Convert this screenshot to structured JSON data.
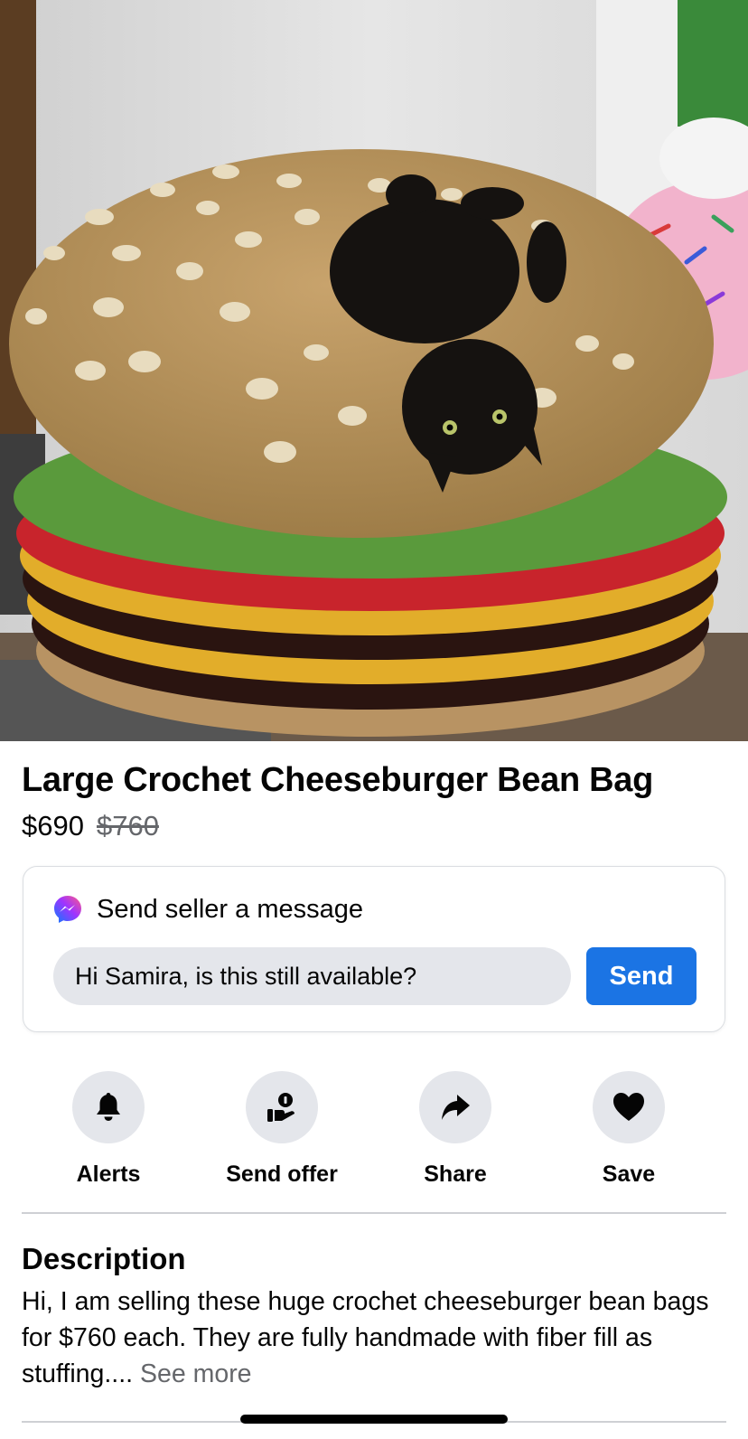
{
  "listing": {
    "title": "Large Crochet Cheeseburger Bean Bag",
    "price": "$690",
    "original_price": "$760",
    "photo_icon": "product-photo"
  },
  "message_card": {
    "heading": "Send seller a message",
    "icon": "messenger-icon",
    "input_value": "Hi Samira, is this still available?",
    "send_label": "Send"
  },
  "actions": [
    {
      "label": "Alerts",
      "icon": "bell-icon"
    },
    {
      "label": "Send offer",
      "icon": "offer-icon"
    },
    {
      "label": "Share",
      "icon": "share-arrow-icon"
    },
    {
      "label": "Save",
      "icon": "heart-icon"
    }
  ],
  "description": {
    "heading": "Description",
    "text": "Hi, I am selling these huge crochet cheeseburger bean bags for $760 each. They are fully handmade with fiber fill as stuffing.... ",
    "see_more": "See more"
  },
  "colors": {
    "accent": "#1b74e4",
    "secondary_text": "#65676b",
    "chip_bg": "#e4e6eb"
  }
}
